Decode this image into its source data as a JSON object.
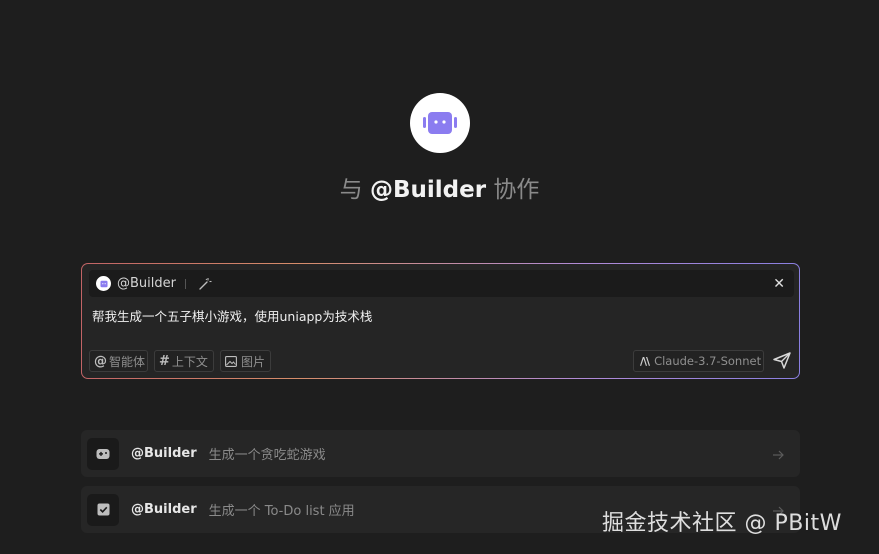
{
  "header": {
    "title_prefix": "与",
    "title_agent": "@Builder",
    "title_suffix": "协作"
  },
  "composer": {
    "agent_chip": "@Builder",
    "prompt": "帮我生成一个五子棋小游戏，使用uniapp为技术栈",
    "tools": [
      {
        "glyph": "@",
        "label": "智能体"
      },
      {
        "glyph": "#",
        "label": "上下文"
      },
      {
        "label": "图片"
      }
    ],
    "model": "Claude-3.7-Sonnet",
    "model_glyph": "/\\\\"
  },
  "suggestions": [
    {
      "agent": "@Builder",
      "text": "生成一个贪吃蛇游戏",
      "icon": "gamepad-icon"
    },
    {
      "agent": "@Builder",
      "text": "生成一个 To-Do list 应用",
      "icon": "checkbox-icon"
    }
  ],
  "watermark": "掘金技术社区 @ PBitW",
  "colors": {
    "accent": "#8b7cf0",
    "background": "#1e1e1e",
    "border_gradient": [
      "#c26466",
      "#d68d6a",
      "#b18bd8",
      "#8a7fe0"
    ]
  }
}
